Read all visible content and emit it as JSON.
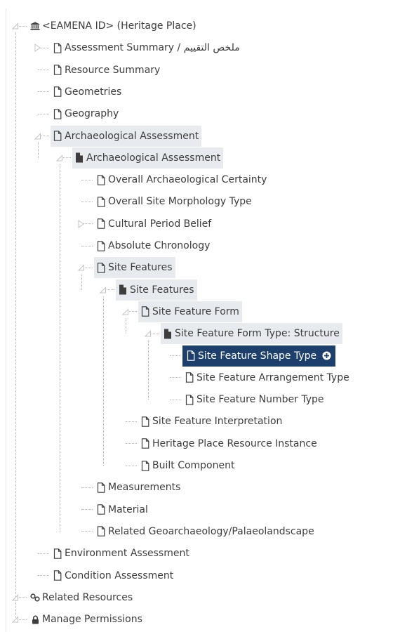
{
  "colors": {
    "text": "#3d3d3d",
    "highlight_bg": "#e7ebef",
    "selected_bg": "#1c3f6b",
    "selected_text": "#ffffff",
    "connector": "#b5b5b5"
  },
  "tree": [
    {
      "label": "<EAMENA ID> (Heritage Place)",
      "icon": "building-icon",
      "toggle": "expanded"
    },
    {
      "label": "Assessment Summary / ملخص التقييم",
      "icon": "file-outline-icon",
      "toggle": "collapsed"
    },
    {
      "label": "Resource Summary",
      "icon": "file-outline-icon"
    },
    {
      "label": "Geometries",
      "icon": "file-outline-icon"
    },
    {
      "label": "Geography",
      "icon": "file-outline-icon"
    },
    {
      "label": "Archaeological Assessment",
      "icon": "file-outline-icon",
      "toggle": "expanded",
      "highlight": true
    },
    {
      "label": "Archaeological Assessment",
      "icon": "file-solid-icon",
      "toggle": "expanded",
      "highlight": true
    },
    {
      "label": "Overall Archaeological Certainty",
      "icon": "file-outline-icon"
    },
    {
      "label": "Overall Site Morphology Type",
      "icon": "file-outline-icon"
    },
    {
      "label": "Cultural Period Belief",
      "icon": "file-outline-icon",
      "toggle": "collapsed"
    },
    {
      "label": "Absolute Chronology",
      "icon": "file-outline-icon"
    },
    {
      "label": "Site Features",
      "icon": "file-outline-icon",
      "toggle": "expanded",
      "highlight": true
    },
    {
      "label": "Site Features",
      "icon": "file-solid-icon",
      "toggle": "expanded",
      "highlight": true
    },
    {
      "label": "Site Feature Form",
      "icon": "file-outline-icon",
      "toggle": "expanded",
      "highlight": true
    },
    {
      "label": "Site Feature Form Type: Structure",
      "icon": "file-solid-icon",
      "toggle": "expanded",
      "highlight": true
    },
    {
      "label": "Site Feature Shape Type",
      "icon": "file-outline-icon",
      "selected": true,
      "action_icon": "plus-circle-icon"
    },
    {
      "label": "Site Feature Arrangement Type",
      "icon": "file-outline-icon"
    },
    {
      "label": "Site Feature Number Type",
      "icon": "file-outline-icon"
    },
    {
      "label": "Site Feature Interpretation",
      "icon": "file-outline-icon"
    },
    {
      "label": "Heritage Place Resource Instance",
      "icon": "file-outline-icon"
    },
    {
      "label": "Built Component",
      "icon": "file-outline-icon"
    },
    {
      "label": "Measurements",
      "icon": "file-outline-icon"
    },
    {
      "label": "Material",
      "icon": "file-outline-icon"
    },
    {
      "label": "Related Geoarchaeology/Palaeolandscape",
      "icon": "file-outline-icon"
    },
    {
      "label": "Environment Assessment",
      "icon": "file-outline-icon"
    },
    {
      "label": "Condition Assessment",
      "icon": "file-outline-icon"
    },
    {
      "label": "Related Resources",
      "icon": "link-icon",
      "toggle": "expanded"
    },
    {
      "label": "Manage Permissions",
      "icon": "lock-icon",
      "toggle": "expanded"
    }
  ]
}
